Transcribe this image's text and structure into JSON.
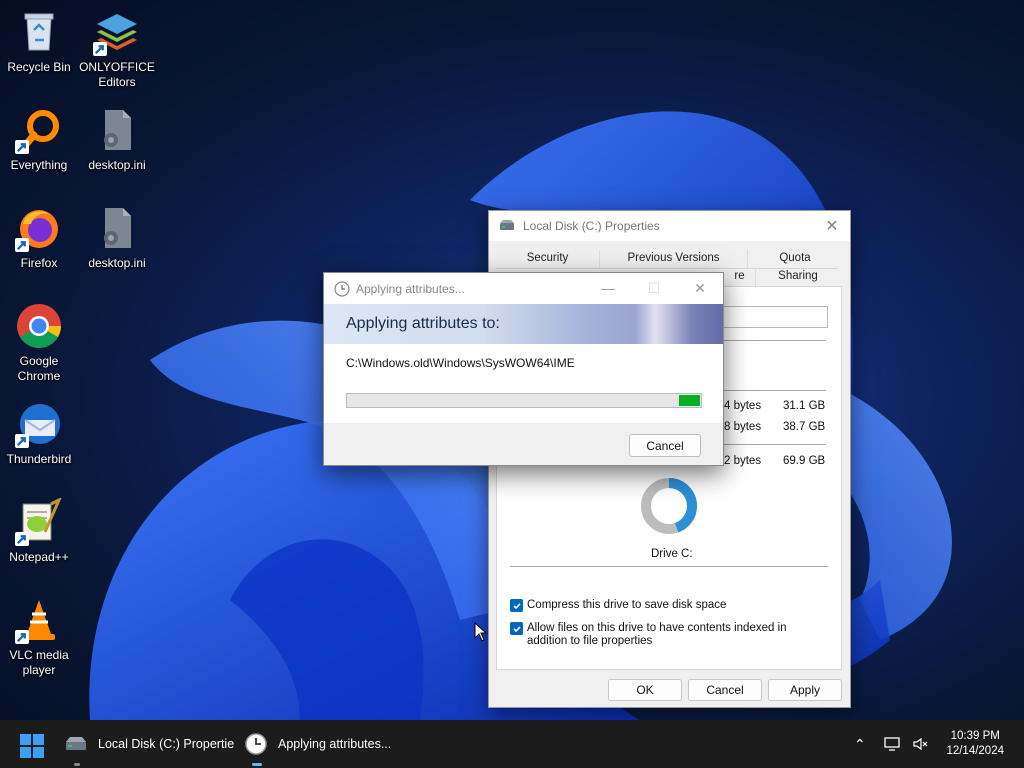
{
  "desktop": {
    "icons": [
      {
        "label": "Recycle Bin",
        "icon": "recycle-bin-icon"
      },
      {
        "label": "ONLYOFFICE Editors",
        "icon": "onlyoffice-icon"
      },
      {
        "label": "Everything",
        "icon": "everything-search-icon"
      },
      {
        "label": "desktop.ini",
        "icon": "settings-file-icon"
      },
      {
        "label": "Firefox",
        "icon": "firefox-icon"
      },
      {
        "label": "desktop.ini",
        "icon": "settings-file-icon"
      },
      {
        "label": "Google Chrome",
        "icon": "chrome-icon"
      },
      {
        "label": "Thunderbird",
        "icon": "thunderbird-icon"
      },
      {
        "label": "Notepad++",
        "icon": "notepadplusplus-icon"
      },
      {
        "label": "VLC media player",
        "icon": "vlc-icon"
      }
    ]
  },
  "properties_window": {
    "title": "Local Disk (C:) Properties",
    "tabs_row1": [
      "Security",
      "Previous Versions",
      "Quota"
    ],
    "tabs_row2_partial": [
      "re",
      "Sharing"
    ],
    "rows": [
      {
        "bytes": "4 bytes",
        "size": "31.1 GB"
      },
      {
        "bytes": "8 bytes",
        "size": "38.7 GB"
      },
      {
        "bytes": "2 bytes",
        "size": "69.9 GB"
      }
    ],
    "drive_label": "Drive C:",
    "used_fraction": 0.445,
    "compress_label": "Compress this drive to save disk space",
    "compress_checked": true,
    "index_label": "Allow files on this drive to have contents indexed in addition to file properties",
    "index_checked": true,
    "ok": "OK",
    "cancel": "Cancel",
    "apply": "Apply"
  },
  "apply_dialog": {
    "title": "Applying attributes...",
    "heading": "Applying attributes to:",
    "path": "C:\\Windows.old\\Windows\\SysWOW64\\IME",
    "progress_fraction": 0.06,
    "cancel": "Cancel"
  },
  "taskbar": {
    "apps": [
      {
        "label": "Local Disk (C:) Propertie"
      },
      {
        "label": "Applying attributes..."
      }
    ],
    "time": "10:39 PM",
    "date": "12/14/2024"
  },
  "colors": {
    "accent": "#0067c0",
    "progress": "#06b025",
    "donut_used": "#2d8fd5",
    "donut_free": "#bdbdbd"
  }
}
